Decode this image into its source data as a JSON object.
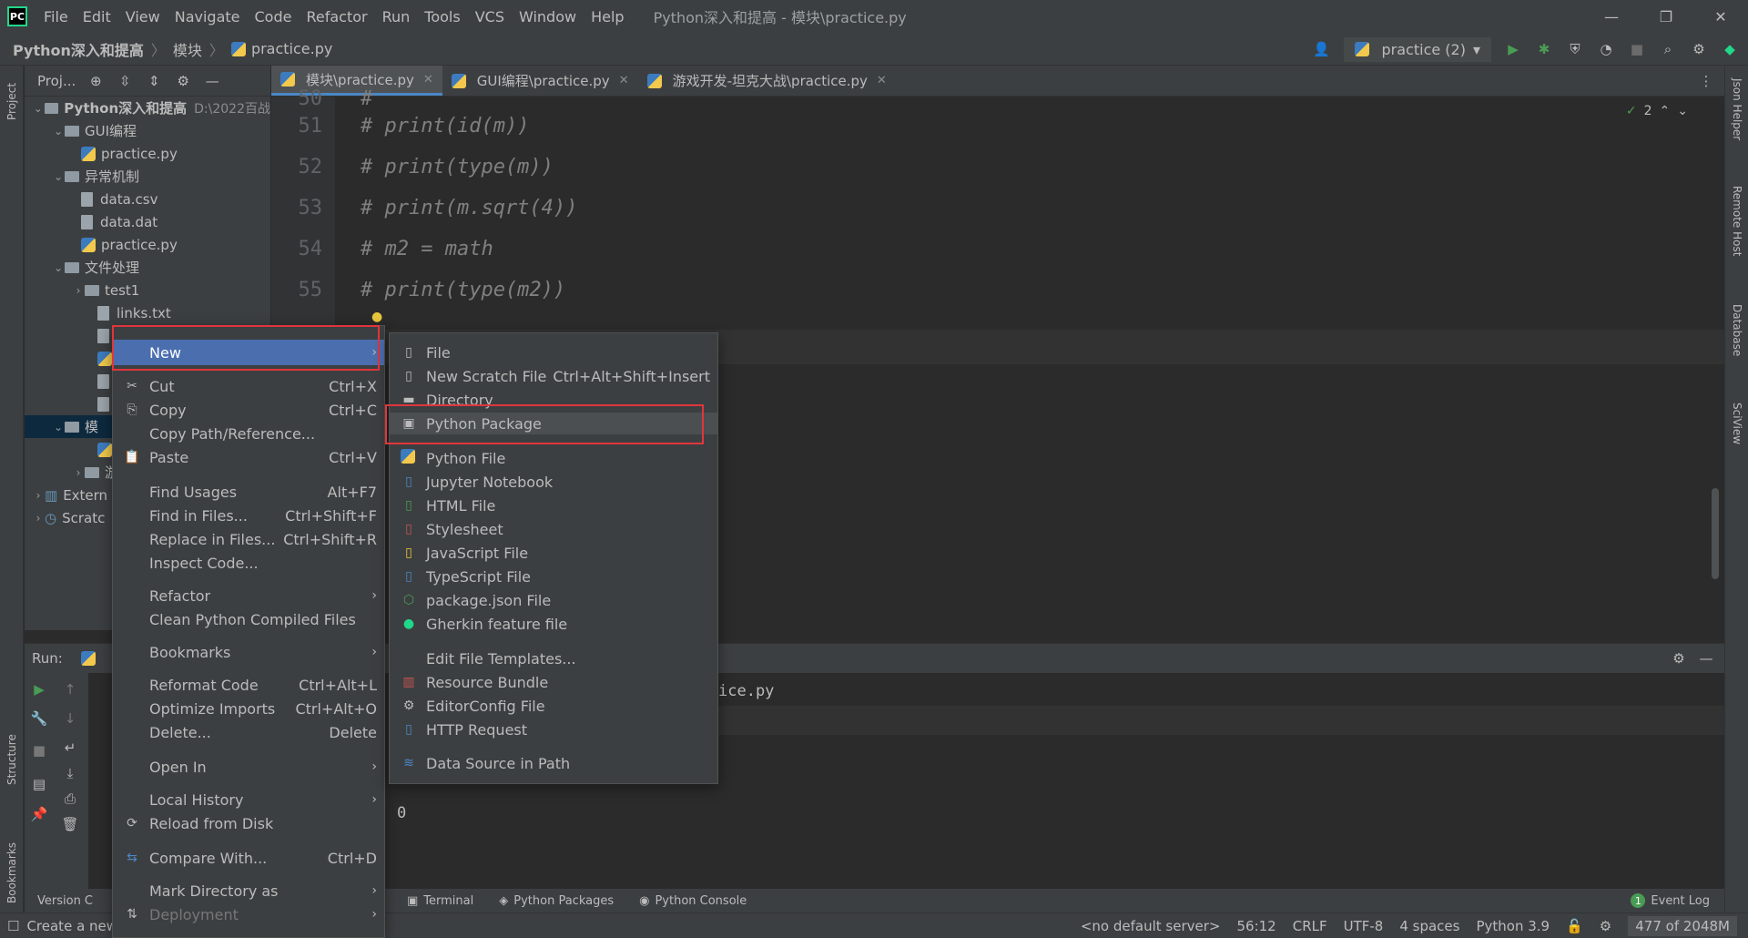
{
  "titlebar": {
    "menu": [
      "File",
      "Edit",
      "View",
      "Navigate",
      "Code",
      "Refactor",
      "Run",
      "Tools",
      "VCS",
      "Window",
      "Help"
    ],
    "window_title": "Python深入和提高 - 模块\\practice.py"
  },
  "navbar": {
    "crumbs": [
      "Python深入和提高",
      "模块",
      "practice.py"
    ],
    "run_config": "practice (2)"
  },
  "project": {
    "header": "Proj...",
    "root_name": "Python深入和提高",
    "root_path": "D:\\2022百战",
    "items": [
      "GUI编程",
      "practice.py",
      "异常机制",
      "data.csv",
      "data.dat",
      "practice.py",
      "文件处理",
      "test1",
      "links.txt",
      "模",
      "游",
      "Extern",
      "Scratc"
    ]
  },
  "tabs": [
    "模块\\practice.py",
    "GUI编程\\practice.py",
    "游戏开发-坦克大战\\practice.py"
  ],
  "editor": {
    "lines": [
      {
        "n": "50",
        "code": "#"
      },
      {
        "n": "51",
        "code": "# print(id(m))"
      },
      {
        "n": "52",
        "code": "# print(type(m))"
      },
      {
        "n": "53",
        "code": "# print(m.sqrt(4))"
      },
      {
        "n": "54",
        "code": "# m2 = math"
      },
      {
        "n": "55",
        "code": "# print(type(m2))"
      }
    ],
    "inspections": "2"
  },
  "run": {
    "label": "Run:",
    "output_path": "ice.py",
    "output_value": "0"
  },
  "context_menu": {
    "items": [
      {
        "label": "New",
        "shortcut": "",
        "sub": true
      },
      {
        "label": "Cut",
        "shortcut": "Ctrl+X"
      },
      {
        "label": "Copy",
        "shortcut": "Ctrl+C"
      },
      {
        "label": "Copy Path/Reference...",
        "shortcut": ""
      },
      {
        "label": "Paste",
        "shortcut": "Ctrl+V"
      },
      {
        "label": "Find Usages",
        "shortcut": "Alt+F7"
      },
      {
        "label": "Find in Files...",
        "shortcut": "Ctrl+Shift+F"
      },
      {
        "label": "Replace in Files...",
        "shortcut": "Ctrl+Shift+R"
      },
      {
        "label": "Inspect Code...",
        "shortcut": ""
      },
      {
        "label": "Refactor",
        "shortcut": "",
        "sub": true
      },
      {
        "label": "Clean Python Compiled Files",
        "shortcut": ""
      },
      {
        "label": "Bookmarks",
        "shortcut": "",
        "sub": true
      },
      {
        "label": "Reformat Code",
        "shortcut": "Ctrl+Alt+L"
      },
      {
        "label": "Optimize Imports",
        "shortcut": "Ctrl+Alt+O"
      },
      {
        "label": "Delete...",
        "shortcut": "Delete"
      },
      {
        "label": "Open In",
        "shortcut": "",
        "sub": true
      },
      {
        "label": "Local History",
        "shortcut": "",
        "sub": true
      },
      {
        "label": "Reload from Disk",
        "shortcut": ""
      },
      {
        "label": "Compare With...",
        "shortcut": "Ctrl+D"
      },
      {
        "label": "Mark Directory as",
        "shortcut": "",
        "sub": true
      },
      {
        "label": "Deployment",
        "shortcut": "",
        "sub": true
      }
    ]
  },
  "submenu": {
    "items": [
      {
        "label": "File",
        "shortcut": ""
      },
      {
        "label": "New Scratch File",
        "shortcut": "Ctrl+Alt+Shift+Insert"
      },
      {
        "label": "Directory",
        "shortcut": ""
      },
      {
        "label": "Python Package",
        "shortcut": ""
      },
      {
        "label": "Python File",
        "shortcut": ""
      },
      {
        "label": "Jupyter Notebook",
        "shortcut": ""
      },
      {
        "label": "HTML File",
        "shortcut": ""
      },
      {
        "label": "Stylesheet",
        "shortcut": ""
      },
      {
        "label": "JavaScript File",
        "shortcut": ""
      },
      {
        "label": "TypeScript File",
        "shortcut": ""
      },
      {
        "label": "package.json File",
        "shortcut": ""
      },
      {
        "label": "Gherkin feature file",
        "shortcut": ""
      },
      {
        "label": "Edit File Templates...",
        "shortcut": ""
      },
      {
        "label": "Resource Bundle",
        "shortcut": ""
      },
      {
        "label": "EditorConfig File",
        "shortcut": ""
      },
      {
        "label": "HTTP Request",
        "shortcut": ""
      },
      {
        "label": "Data Source in Path",
        "shortcut": ""
      }
    ]
  },
  "side_tabs": {
    "left": [
      "Project",
      "Structure",
      "Bookmarks"
    ],
    "right": [
      "Json Helper",
      "Remote Host",
      "Database",
      "SciView"
    ]
  },
  "bottom_tabs": [
    "Terminal",
    "Python Packages",
    "Python Console"
  ],
  "left_bottom": [
    "Version C",
    "Create a new"
  ],
  "status": {
    "event_log": "Event Log",
    "event_count": "1",
    "server": "<no default server>",
    "position": "56:12",
    "line_sep": "CRLF",
    "encoding": "UTF-8",
    "indent": "4 spaces",
    "interpreter": "Python 3.9",
    "memory": "477 of 2048M"
  }
}
